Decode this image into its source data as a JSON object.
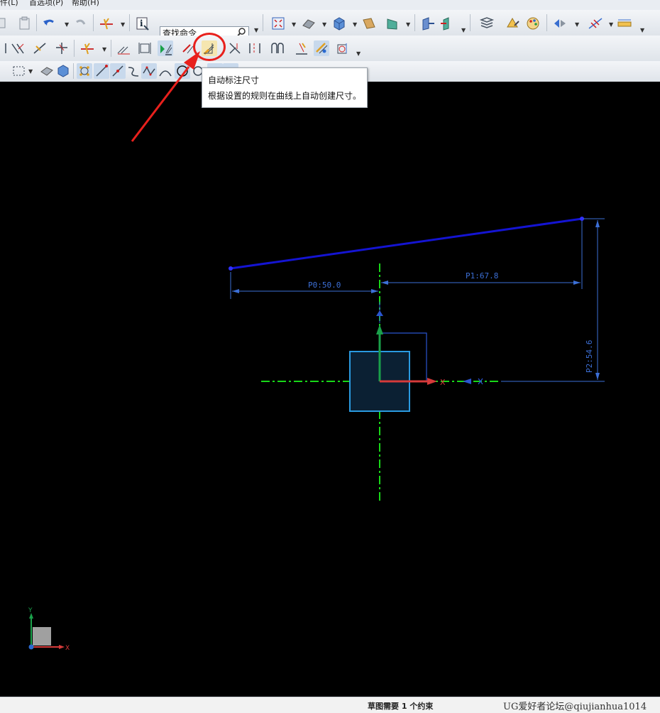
{
  "menubar": {
    "items": [
      "件(L)",
      "首选项(P)",
      "帮助(H)"
    ]
  },
  "toolbar": {
    "search_placeholder": "查找命令"
  },
  "tooltip": {
    "title": "自动标注尺寸",
    "description": "根据设置的规则在曲线上自动创建尺寸。"
  },
  "sketch": {
    "dim_p0": "P0:50.0",
    "dim_p1": "P1:67.8",
    "dim_p2": "P2:54.6",
    "axis_x_label": "X",
    "triad_x_label": "X",
    "triad_y_label": "Y"
  },
  "status": {
    "message": "草图需要 1 个约束",
    "watermark": "UG爱好者论坛@qiujianhua1014"
  },
  "colors": {
    "canvas_bg": "#000000",
    "sketch_line": "#1414d2",
    "dimension": "#3c6fd6",
    "centerline": "#18d818",
    "datum_square": "#2a9ae0",
    "highlight": "#e8201c"
  }
}
